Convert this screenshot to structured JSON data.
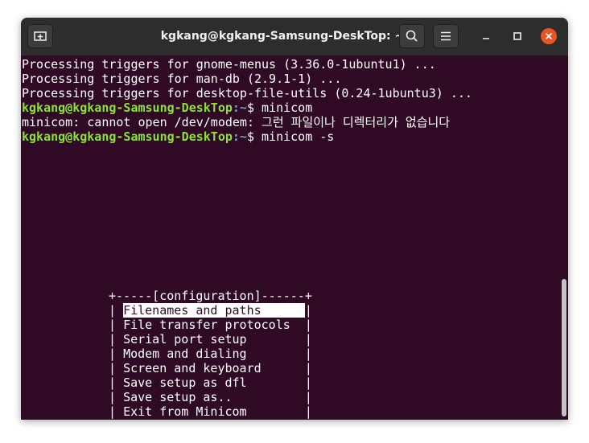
{
  "window": {
    "title": "kgkang@kgkang-Samsung-DeskTop: ~",
    "colors": {
      "terminal_bg": "#300a24",
      "titlebar_bg": "#2d2d2d",
      "prompt_user": "#8ae234",
      "prompt_path": "#729fcf",
      "close": "#e95420"
    },
    "icons": [
      "new-tab-icon",
      "search-icon",
      "hamburger-menu-icon",
      "minimize-icon",
      "maximize-icon",
      "close-icon"
    ]
  },
  "terminal": {
    "output1": "Processing triggers for gnome-menus (3.36.0-1ubuntu1) ...",
    "output2": "Processing triggers for man-db (2.9.1-1) ...",
    "output3": "Processing triggers for desktop-file-utils (0.24-1ubuntu3) ...",
    "prompt_user": "kgkang@kgkang-Samsung-DeskTop",
    "prompt_path": ":~",
    "prompt_symbol": "$ ",
    "cmd1": "minicom",
    "error": "minicom: cannot open /dev/modem: 그런 파일이나 디렉터리가 없습니다",
    "cmd2": "minicom -s"
  },
  "menu": {
    "top_border": "+-----[configuration]------+",
    "left_border": "| ",
    "right_border": "|",
    "items": [
      "Filenames and paths      ",
      "File transfer protocols  ",
      "Serial port setup        ",
      "Modem and dialing        ",
      "Screen and keyboard      ",
      "Save setup as dfl        ",
      "Save setup as..          ",
      "Exit from Minicom        "
    ],
    "selected_index": 0
  }
}
